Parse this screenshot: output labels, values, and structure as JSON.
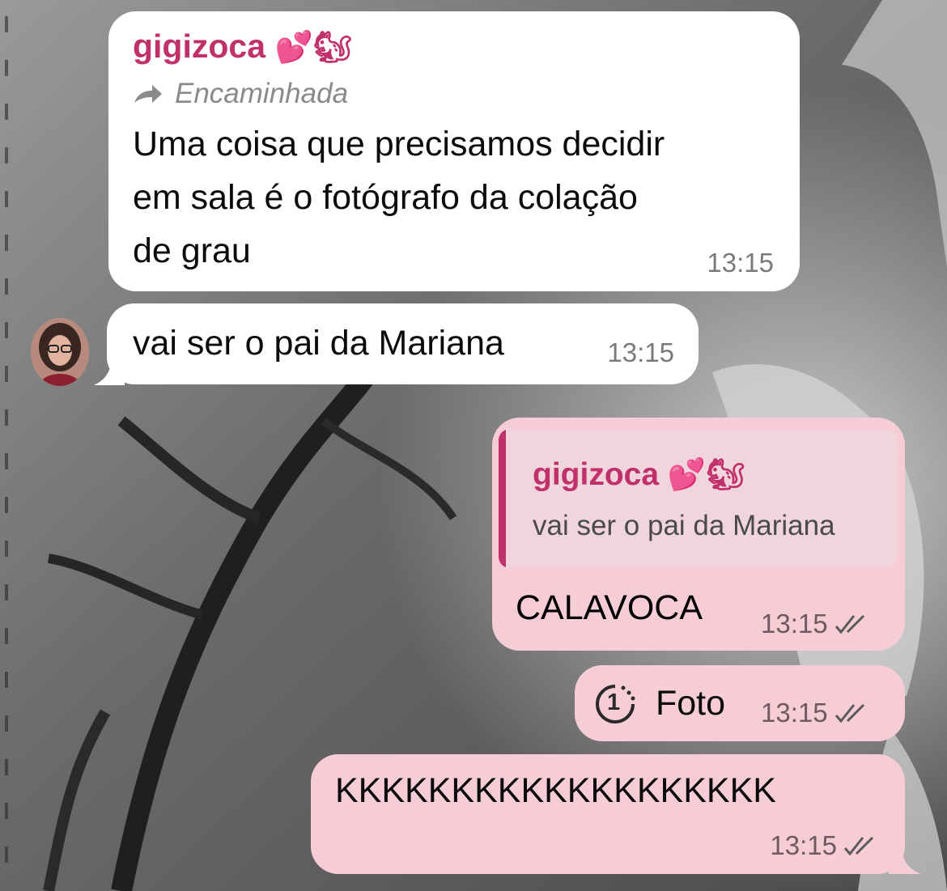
{
  "chat": {
    "forwarded_message": {
      "sender": "gigizoca",
      "sender_emoji": "💕🐿",
      "forwarded_label": "Encaminhada",
      "lines": [
        "Uma coisa que precisamos decidir",
        "em sala é o fotógrafo da colação",
        "de grau"
      ],
      "time": "13:15"
    },
    "incoming_message": {
      "text": "vai ser o pai da Mariana",
      "time": "13:15"
    },
    "reply_message": {
      "quote_sender": "gigizoca",
      "quote_sender_emoji": "💕🐿",
      "quote_text": "vai ser o pai da Mariana",
      "text": "CALAVOCA",
      "time": "13:15"
    },
    "photo_message": {
      "view_once_count": "1",
      "label": "Foto",
      "time": "13:15"
    },
    "laugh_message": {
      "text": "KKKKKKKKKKKKKKKKKKK",
      "time": "13:15"
    },
    "colors": {
      "incoming_bubble": "#ffffff",
      "outgoing_bubble": "#f6cdd6",
      "sender_name": "#c0306b"
    }
  }
}
